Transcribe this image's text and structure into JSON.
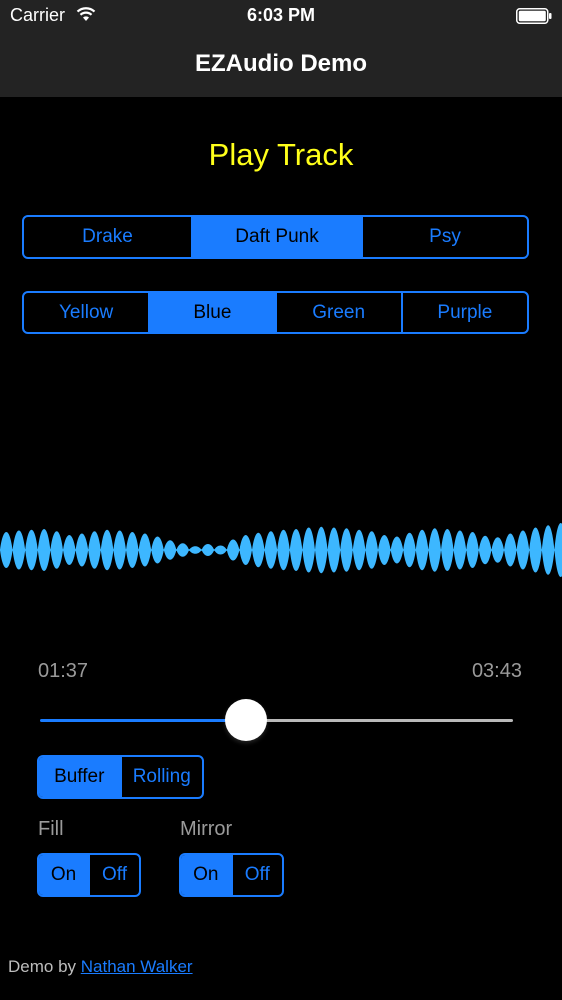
{
  "status_bar": {
    "carrier": "Carrier",
    "time": "6:03 PM",
    "icons": [
      "wifi-icon",
      "battery-icon"
    ]
  },
  "nav": {
    "title": "EZAudio Demo"
  },
  "play_button": {
    "label": "Play Track"
  },
  "track_selector": {
    "options": [
      "Drake",
      "Daft Punk",
      "Psy"
    ],
    "selected": "Daft Punk"
  },
  "color_selector": {
    "options": [
      "Yellow",
      "Blue",
      "Green",
      "Purple"
    ],
    "selected": "Blue"
  },
  "waveform": {
    "color": "#3db7ff"
  },
  "playback": {
    "current_time": "01:37",
    "total_time": "03:43",
    "progress": 0.435
  },
  "plot_type": {
    "options": [
      "Buffer",
      "Rolling"
    ],
    "selected": "Buffer"
  },
  "fill": {
    "label": "Fill",
    "options": [
      "On",
      "Off"
    ],
    "selected": "On"
  },
  "mirror": {
    "label": "Mirror",
    "options": [
      "On",
      "Off"
    ],
    "selected": "On"
  },
  "footer": {
    "prefix": "Demo by ",
    "link_text": "Nathan Walker"
  },
  "colors": {
    "accent": "#1a7cff",
    "play_text": "#ffff1a",
    "bars": "#232323"
  }
}
